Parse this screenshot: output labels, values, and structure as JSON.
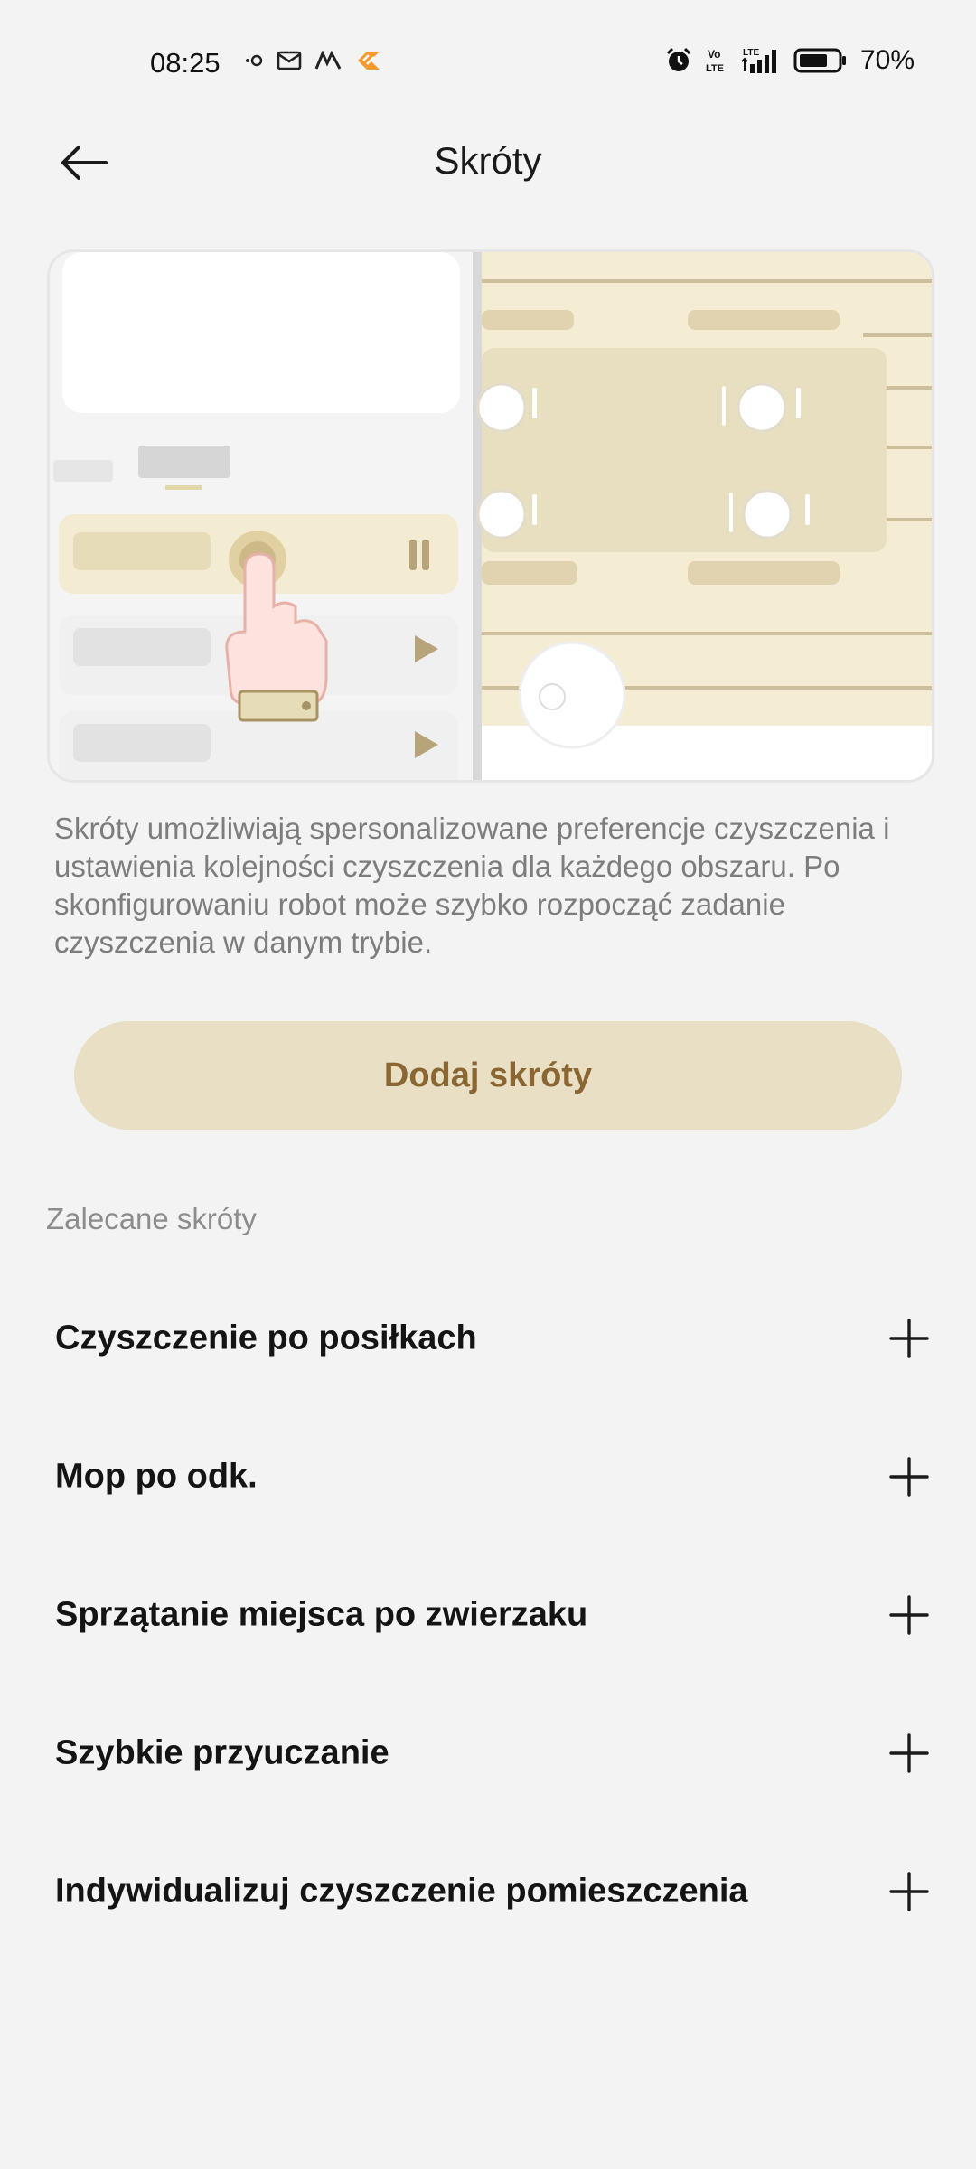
{
  "status_bar": {
    "time": "08:25",
    "battery": "70%",
    "left_icons": [
      "hotspot-icon",
      "mail-icon",
      "app-icon",
      "app-orange-icon"
    ],
    "right_icons": [
      "alarm-icon",
      "volte-icon",
      "signal-icon",
      "battery-icon"
    ],
    "volte_text": "Vo\nLTE",
    "lte_text": "LTE"
  },
  "header": {
    "title": "Skróty",
    "back_icon": "arrow-left-icon"
  },
  "description": "Skróty umożliwiają spersonalizowane preferencje czyszczenia i ustawienia kolejności czyszczenia dla każdego obszaru. Po skonfigurowaniu robot może szybko rozpocząć zadanie czyszczenia w danym trybie.",
  "add_button": {
    "label": "Dodaj skróty"
  },
  "section": {
    "label": "Zalecane skróty"
  },
  "shortcuts": [
    {
      "label": "Czyszczenie po posiłkach"
    },
    {
      "label": "Mop po odk."
    },
    {
      "label": "Sprzątanie miejsca po zwierzaku"
    },
    {
      "label": "Szybkie przyuczanie"
    },
    {
      "label": "Indywidualizuj czyszczenie pomieszczenia"
    }
  ],
  "colors": {
    "background": "#f3f3f3",
    "button_bg": "#e8dfc5",
    "button_text": "#8a6633",
    "accent_beige": "#e8dfc0"
  }
}
